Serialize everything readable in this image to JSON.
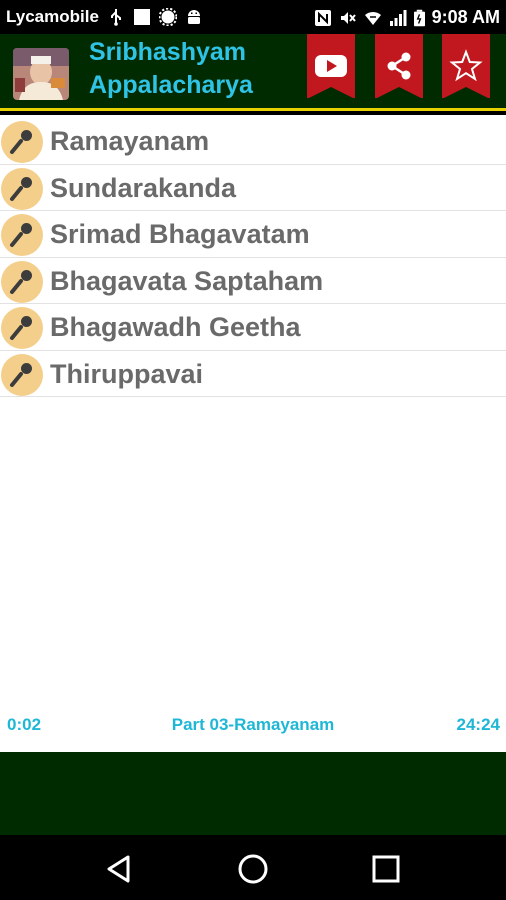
{
  "status_bar": {
    "carrier": "Lycamobile",
    "time": "9:08 AM",
    "left_icons": [
      "usb-icon",
      "square-notification-icon",
      "gear-notification-icon",
      "android-icon"
    ],
    "right_icons": [
      "nfc-icon",
      "mute-icon",
      "wifi-icon",
      "signal-icon",
      "battery-icon"
    ]
  },
  "app_bar": {
    "title_line1": "Sribhashyam",
    "title_line2": "Appalacharya",
    "actions": [
      {
        "name": "youtube-button",
        "icon": "youtube-icon"
      },
      {
        "name": "share-button",
        "icon": "share-icon"
      },
      {
        "name": "favorite-button",
        "icon": "star-icon"
      }
    ],
    "colors": {
      "bar": "#002b00",
      "title": "#2fc3e6",
      "ribbon": "#c0181e",
      "accent_line": "#e8d200"
    }
  },
  "list": {
    "items": [
      {
        "label": "Ramayanam",
        "icon": "microphone-icon"
      },
      {
        "label": "Sundarakanda",
        "icon": "microphone-icon"
      },
      {
        "label": "Srimad Bhagavatam",
        "icon": "microphone-icon"
      },
      {
        "label": "Bhagavata Saptaham",
        "icon": "microphone-icon"
      },
      {
        "label": "Bhagawadh Geetha",
        "icon": "microphone-icon"
      },
      {
        "label": "Thiruppavai",
        "icon": "microphone-icon"
      }
    ]
  },
  "player": {
    "current_time": "0:02",
    "track_title": "Part 03-Ramayanam",
    "total_time": "24:24",
    "color": "#1fb7d6"
  },
  "nav_bar": {
    "icons": [
      "back-icon",
      "home-icon",
      "recents-icon"
    ]
  }
}
